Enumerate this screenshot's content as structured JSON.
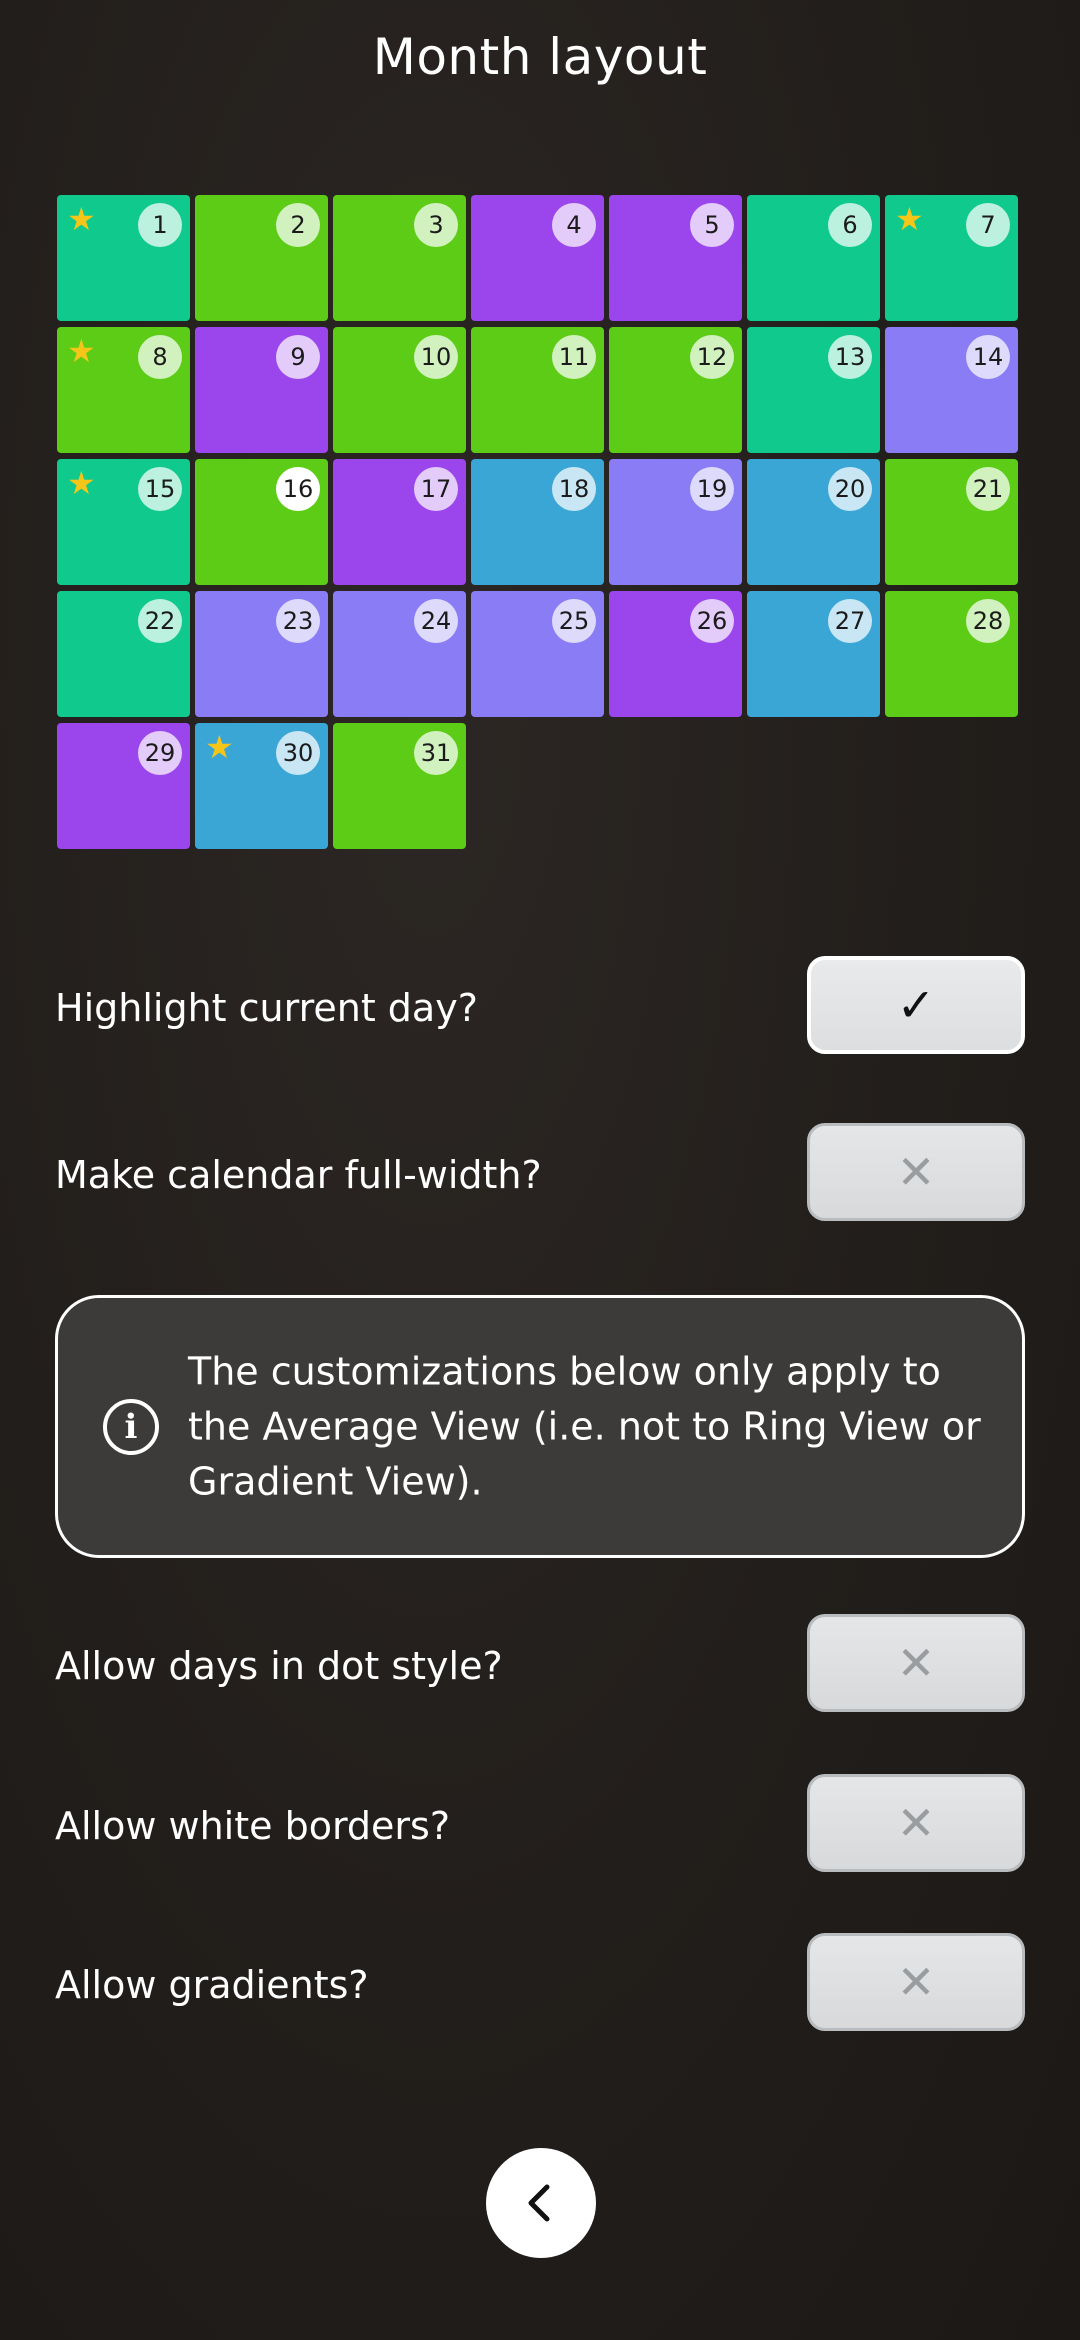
{
  "header": {
    "title": "Month layout"
  },
  "colors": {
    "teal": "#10c98c",
    "green": "#5ccc16",
    "purple": "#9b45ec",
    "periwinkle": "#8a7cf4",
    "blue": "#3aa6d6",
    "star": "#f5c518"
  },
  "calendar": {
    "current_day": 16,
    "days": [
      {
        "n": "1",
        "color": "teal",
        "star": true
      },
      {
        "n": "2",
        "color": "green",
        "star": false
      },
      {
        "n": "3",
        "color": "green",
        "star": false
      },
      {
        "n": "4",
        "color": "purple",
        "star": false
      },
      {
        "n": "5",
        "color": "purple",
        "star": false
      },
      {
        "n": "6",
        "color": "teal",
        "star": false
      },
      {
        "n": "7",
        "color": "teal",
        "star": true
      },
      {
        "n": "8",
        "color": "green",
        "star": true
      },
      {
        "n": "9",
        "color": "purple",
        "star": false
      },
      {
        "n": "10",
        "color": "green",
        "star": false
      },
      {
        "n": "11",
        "color": "green",
        "star": false
      },
      {
        "n": "12",
        "color": "green",
        "star": false
      },
      {
        "n": "13",
        "color": "teal",
        "star": false
      },
      {
        "n": "14",
        "color": "periwinkle",
        "star": false
      },
      {
        "n": "15",
        "color": "teal",
        "star": true
      },
      {
        "n": "16",
        "color": "green",
        "star": false
      },
      {
        "n": "17",
        "color": "purple",
        "star": false
      },
      {
        "n": "18",
        "color": "blue",
        "star": false
      },
      {
        "n": "19",
        "color": "periwinkle",
        "star": false
      },
      {
        "n": "20",
        "color": "blue",
        "star": false
      },
      {
        "n": "21",
        "color": "green",
        "star": false
      },
      {
        "n": "22",
        "color": "teal",
        "star": false
      },
      {
        "n": "23",
        "color": "periwinkle",
        "star": false
      },
      {
        "n": "24",
        "color": "periwinkle",
        "star": false
      },
      {
        "n": "25",
        "color": "periwinkle",
        "star": false
      },
      {
        "n": "26",
        "color": "purple",
        "star": false
      },
      {
        "n": "27",
        "color": "blue",
        "star": false
      },
      {
        "n": "28",
        "color": "green",
        "star": false
      },
      {
        "n": "29",
        "color": "purple",
        "star": false
      },
      {
        "n": "30",
        "color": "blue",
        "star": true
      },
      {
        "n": "31",
        "color": "green",
        "star": false
      }
    ]
  },
  "settings": {
    "highlight_current_day": {
      "label": "Highlight current day?",
      "checked": true
    },
    "full_width": {
      "label": "Make calendar full-width?",
      "checked": false
    },
    "dot_style": {
      "label": "Allow days in dot style?",
      "checked": false
    },
    "white_borders": {
      "label": "Allow white borders?",
      "checked": false
    },
    "gradients": {
      "label": "Allow gradients?",
      "checked": false
    }
  },
  "info": {
    "icon": "info-icon",
    "text": "The customizations below only apply to the Average View (i.e. not to Ring View or Gradient View)."
  },
  "icons": {
    "check": "✓",
    "cross": "✕",
    "star": "★",
    "back": "chevron-left-icon"
  }
}
